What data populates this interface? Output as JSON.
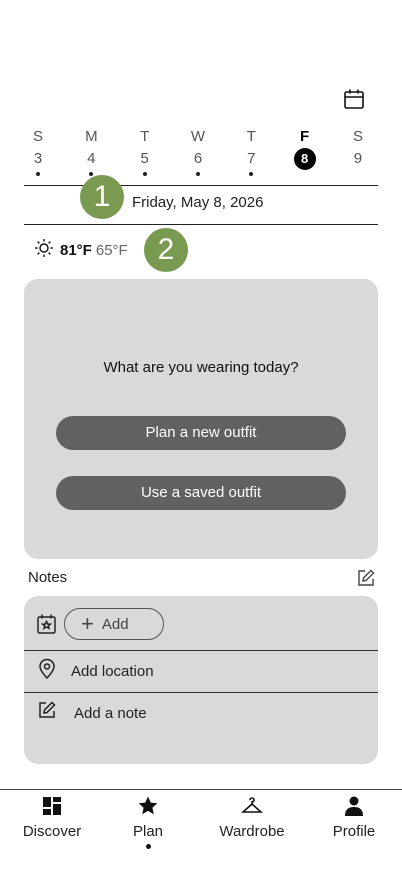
{
  "calendar": {
    "days": [
      {
        "dow": "S",
        "num": "3",
        "dot": true,
        "selected": false
      },
      {
        "dow": "M",
        "num": "4",
        "dot": true,
        "selected": false
      },
      {
        "dow": "T",
        "num": "5",
        "dot": true,
        "selected": false
      },
      {
        "dow": "W",
        "num": "6",
        "dot": true,
        "selected": false
      },
      {
        "dow": "T",
        "num": "7",
        "dot": true,
        "selected": false
      },
      {
        "dow": "F",
        "num": "8",
        "dot": false,
        "selected": true
      },
      {
        "dow": "S",
        "num": "9",
        "dot": false,
        "selected": false
      }
    ],
    "selected_date": "Friday, May 8, 2026"
  },
  "badges": {
    "one": "1",
    "two": "2"
  },
  "weather": {
    "icon": "sun-icon",
    "high": "81°F",
    "low": "65°F"
  },
  "outfit_card": {
    "question": "What are you wearing today?",
    "plan_new": "Plan a new outfit",
    "use_saved": "Use a saved outfit"
  },
  "notes": {
    "label": "Notes",
    "add_label": "Add",
    "location_label": "Add location",
    "note_label": "Add a note"
  },
  "nav": {
    "items": [
      {
        "label": "Discover",
        "icon": "grid-icon"
      },
      {
        "label": "Plan",
        "icon": "star-icon",
        "active": true
      },
      {
        "label": "Wardrobe",
        "icon": "hanger-icon"
      },
      {
        "label": "Profile",
        "icon": "person-icon"
      }
    ]
  },
  "colors": {
    "badge": "#7a9a52",
    "card": "#d9d9d9",
    "button": "#616161"
  }
}
